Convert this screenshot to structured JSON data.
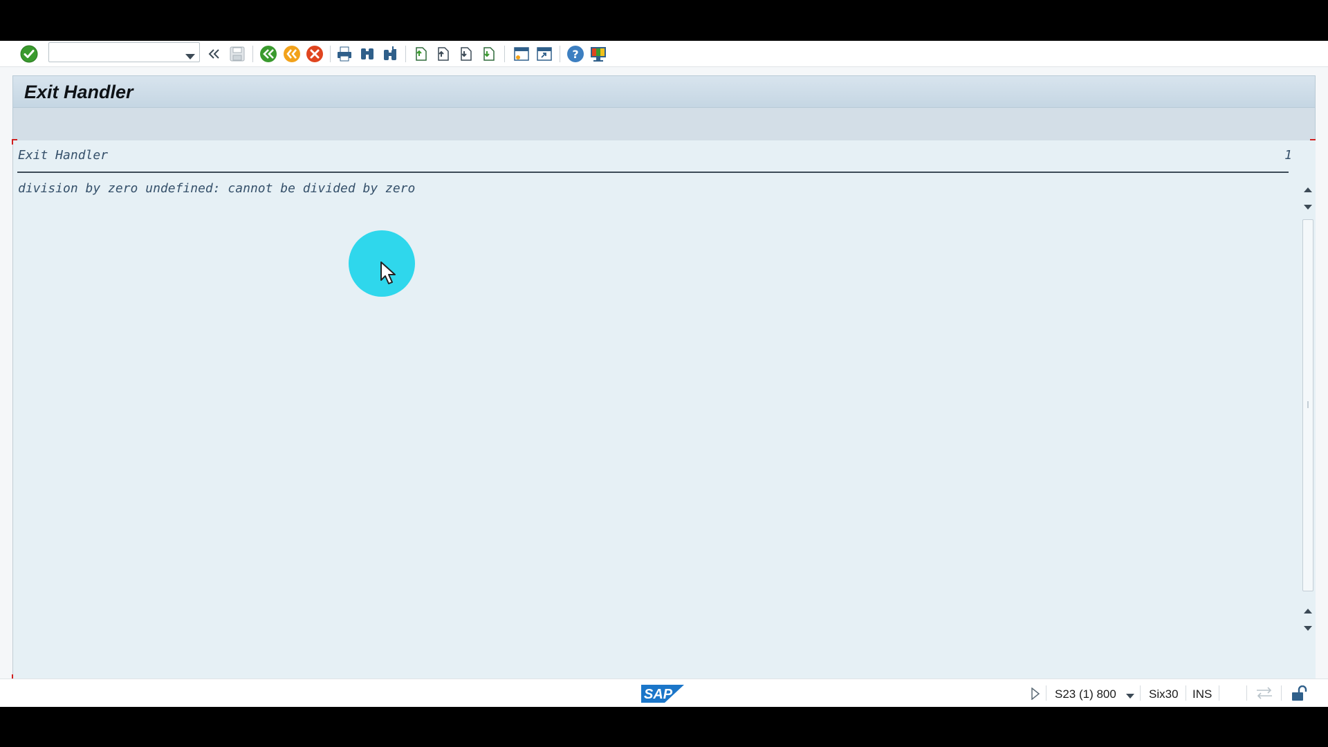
{
  "toolbar": {
    "command_field_value": "",
    "icons": [
      "enter-check-icon",
      "command-dropdown-icon",
      "collapse-chevrons-icon",
      "save-icon",
      "back-icon",
      "exit-icon",
      "cancel-icon",
      "print-icon",
      "find-icon",
      "find-next-icon",
      "first-page-icon",
      "previous-page-icon",
      "next-page-icon",
      "last-page-icon",
      "create-session-icon",
      "shortcut-icon",
      "help-icon",
      "customize-layout-icon"
    ]
  },
  "title": "Exit Handler",
  "list": {
    "header": "Exit Handler",
    "page_number": "1",
    "lines": [
      "division by zero undefined: cannot be divided by zero"
    ]
  },
  "statusbar": {
    "logo_text": "SAP",
    "system": "S23 (1) 800",
    "server": "Six30",
    "mode": "INS"
  },
  "colors": {
    "title_bar": "#c5d6e3",
    "list_background": "#e6f0f5",
    "list_text": "#35506a",
    "cursor_highlight": "#2fd7ec",
    "sap_logo": "#1b76c9"
  }
}
